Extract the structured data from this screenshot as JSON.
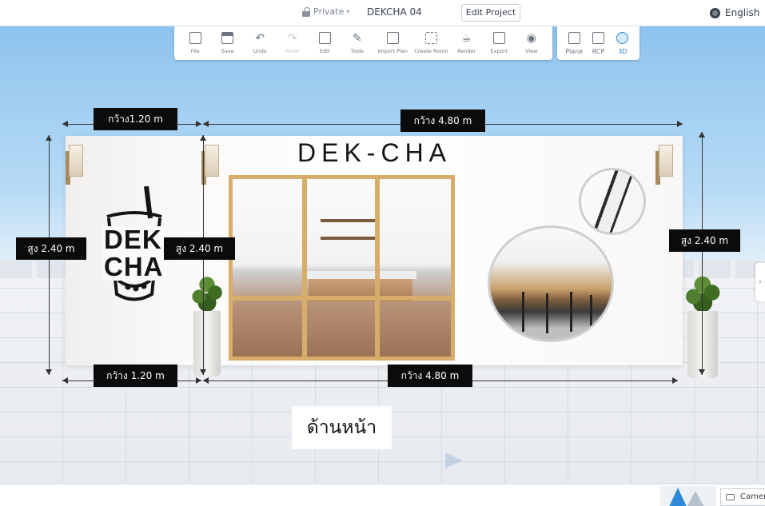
{
  "header": {
    "privacy_label": "Private",
    "project_title": "DEKCHA 04",
    "edit_project_label": "Edit Project",
    "language_label": "English"
  },
  "toolbar": {
    "tools": [
      {
        "label": "File",
        "icon": "file-icon"
      },
      {
        "label": "Save",
        "icon": "save-icon"
      },
      {
        "label": "Undo",
        "icon": "undo-icon"
      },
      {
        "label": "Redo",
        "icon": "redo-icon"
      },
      {
        "label": "Edit",
        "icon": "edit-icon"
      },
      {
        "label": "Tools",
        "icon": "tools-icon"
      },
      {
        "label": "Import Plan",
        "icon": "import-plan-icon"
      },
      {
        "label": "Create Room",
        "icon": "create-room-icon"
      },
      {
        "label": "Render",
        "icon": "render-icon"
      },
      {
        "label": "Export",
        "icon": "export-icon"
      },
      {
        "label": "View",
        "icon": "view-icon"
      }
    ],
    "views": [
      {
        "label": "Plane",
        "icon": "plane-view-icon"
      },
      {
        "label": "RCP",
        "icon": "rcp-icon"
      },
      {
        "label": "3D",
        "icon": "3d-view-icon",
        "active": true
      }
    ]
  },
  "scene": {
    "brand_sign": "DEK-CHA",
    "logo_line1": "DEK",
    "logo_line2": "CHA",
    "dimensions": {
      "top_left_width": "กว้าง1.20 m",
      "top_right_width": "กว้าง 4.80 m",
      "bottom_left_width": "กว้าง 1.20 m",
      "bottom_right_width": "กว้าง 4.80 m",
      "left_height": "สูง 2.40 m",
      "middle_height": "สูง 2.40 m",
      "right_height": "สูง 2.40 m"
    },
    "side_caption": "ด้านหน้า"
  },
  "status": {
    "camera_label": "Camera"
  },
  "colors": {
    "accent": "#2e8ad8",
    "door_frame": "#d6ad6a",
    "dimension_label_bg": "#0b0b0b"
  }
}
